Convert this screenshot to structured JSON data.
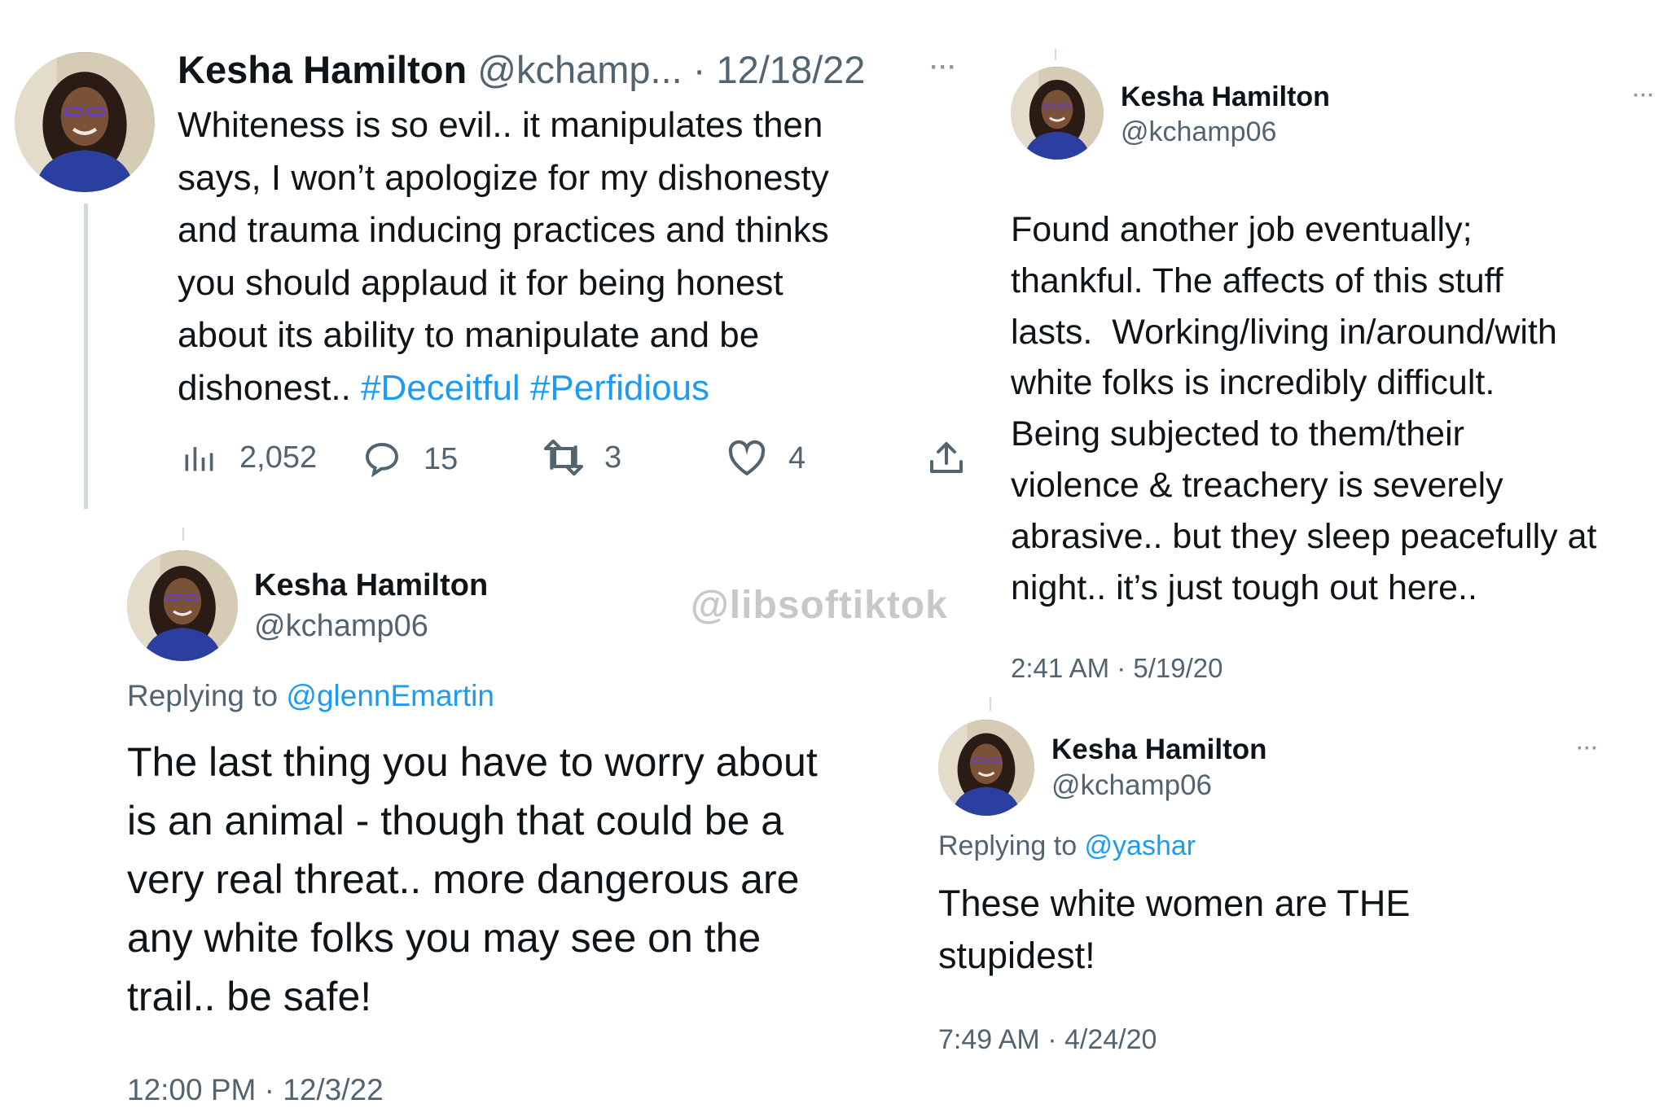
{
  "tweet_main": {
    "name": "Kesha Hamilton",
    "handle_date": "@kchamp... · 12/18/22",
    "more": "···",
    "lines": [
      "Whiteness is so evil.. it manipulates then",
      "says, I won’t apologize for my dishonesty",
      "and trauma inducing practices and thinks",
      "you should applaud it for being honest",
      "about its ability to manipulate and be"
    ],
    "last_line_text": "dishonest.. ",
    "hashtags": "#Deceitful #Perfidious",
    "views": "2,052",
    "replies": "15",
    "retweets": "3",
    "likes": "4"
  },
  "tweet_right_top": {
    "name": "Kesha Hamilton",
    "handle": "@kchamp06",
    "more": "···",
    "lines": [
      "Found another job eventually;",
      "thankful. The affects of this stuff",
      "lasts.  Working/living in/around/with",
      "white folks is incredibly difficult.",
      "Being subjected to them/their",
      "violence & treachery is severely",
      "abrasive.. but they sleep peacefully at",
      "night.. it’s just tough out here.."
    ],
    "timestamp": "2:41 AM · 5/19/20"
  },
  "tweet_left_bottom": {
    "name": "Kesha Hamilton",
    "handle": "@kchamp06",
    "replying_prefix": "Replying to ",
    "replying_to": "@glennEmartin",
    "lines": [
      "The last thing you have to worry about",
      "is an animal - though that could be a",
      "very real threat.. more dangerous are",
      "any white folks you may see on the",
      "trail.. be safe!"
    ],
    "timestamp": "12:00 PM · 12/3/22"
  },
  "tweet_right_bottom": {
    "name": "Kesha Hamilton",
    "handle": "@kchamp06",
    "more": "···",
    "replying_prefix": "Replying to ",
    "replying_to": "@yashar",
    "lines": [
      "These white women are THE",
      "stupidest!"
    ],
    "timestamp": "7:49 AM · 4/24/20"
  },
  "watermark": "@libsoftiktok",
  "colors": {
    "link": "#1d9bf0",
    "text": "#0f1419",
    "secondary": "#536471",
    "thread_line": "#cfd9de",
    "avatar_shirt": "#2a3fa0"
  }
}
